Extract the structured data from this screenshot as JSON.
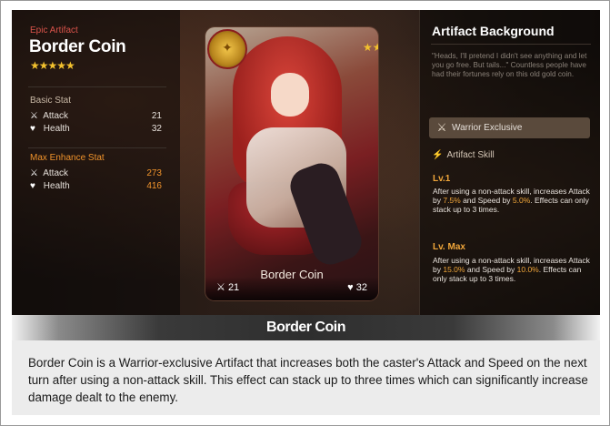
{
  "left": {
    "rarity": "Epic Artifact",
    "name": "Border Coin",
    "stars": "★★★★★",
    "basic_stat_title": "Basic Stat",
    "basic": [
      {
        "icon": "sword-icon",
        "label": "Attack",
        "value": "21"
      },
      {
        "icon": "heart-icon",
        "label": "Health",
        "value": "32"
      }
    ],
    "max_stat_title": "Max Enhance Stat",
    "max": [
      {
        "icon": "sword-icon",
        "label": "Attack",
        "value": "273"
      },
      {
        "icon": "heart-icon",
        "label": "Health",
        "value": "416"
      }
    ]
  },
  "card": {
    "title": "Border Coin",
    "attack": "21",
    "health": "32",
    "stars": "★★★★★"
  },
  "right": {
    "title": "Artifact Background",
    "quote": "\"Heads, I'll pretend I didn't see anything and let you go free. But tails...\" Countless people have had their fortunes rely on this old gold coin.",
    "exclusive": "Warrior Exclusive",
    "skill_title": "Artifact Skill",
    "lv1_label": "Lv.1",
    "lv1_pre": "After using a non-attack skill, increases Attack by ",
    "lv1_attack": "7.5%",
    "lv1_mid": " and Speed by ",
    "lv1_speed": "5.0%",
    "lv1_post": ". Effects can only stack up to 3 times.",
    "lvmax_label": "Lv. Max",
    "lvmax_pre": "After using a non-attack skill, increases Attack by ",
    "lvmax_attack": "15.0%",
    "lvmax_mid": " and Speed by ",
    "lvmax_speed": "10.0%",
    "lvmax_post": ". Effects can only stack up to 3 times."
  },
  "caption": {
    "title": "Border Coin",
    "text": "Border Coin is a Warrior-exclusive Artifact that increases both the caster's Attack and Speed on the next turn after using a non-attack skill. This effect can stack up to three times which can significantly increase damage dealt to the enemy."
  },
  "colors": {
    "accent": "#f0a63a",
    "rarity": "#d9534a",
    "stars": "#f2c12e"
  }
}
